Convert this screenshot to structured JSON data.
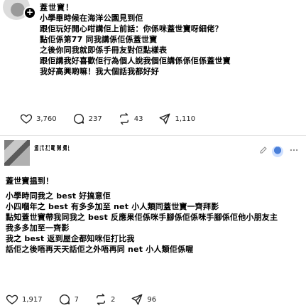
{
  "posts": [
    {
      "follow_badge": "+",
      "lines": [
        "蓋世寶！",
        "小學畢時候在海洋公園見到佢",
        "跟佢玩好開心咁講佢上前話：你係咪蓋世寶呀細佬？",
        "點佢係第77 同我講係佢係蓋世寶",
        "之後你同我就即係手冊友對佢點樣表",
        "跟佢講我好喜歡佢行為個人說我個佢講係係佢係蓋世寶",
        "我好高興啲嘛！我大個話我都好好"
      ],
      "stats": {
        "likes": "3,760",
        "comments": "237",
        "reposts": "43",
        "shares": "1,110"
      }
    },
    {
      "username": "蓋世寶擁躉",
      "lines": [
        "蓋世寶揾到！",
        "",
        "小學時同我之 best 好搞意佢",
        "小四嗰年之 best 有多多加至 net 小人類同蓋世寶一齊拜影",
        "點知蓋世寶帶我同我之 best 反應果佢係咪手腳係佢係咪手腳係佢他小朋友主",
        "我多多加至一齊影",
        "我之 best 返到屋企都知咪佢打比我",
        "話佢之後唔再天天話佢之外唔再同 net 小人類佢係喔",
        ""
      ],
      "stats": {
        "likes": "1,917",
        "comments": "7",
        "reposts": "2",
        "shares": "96"
      }
    }
  ]
}
